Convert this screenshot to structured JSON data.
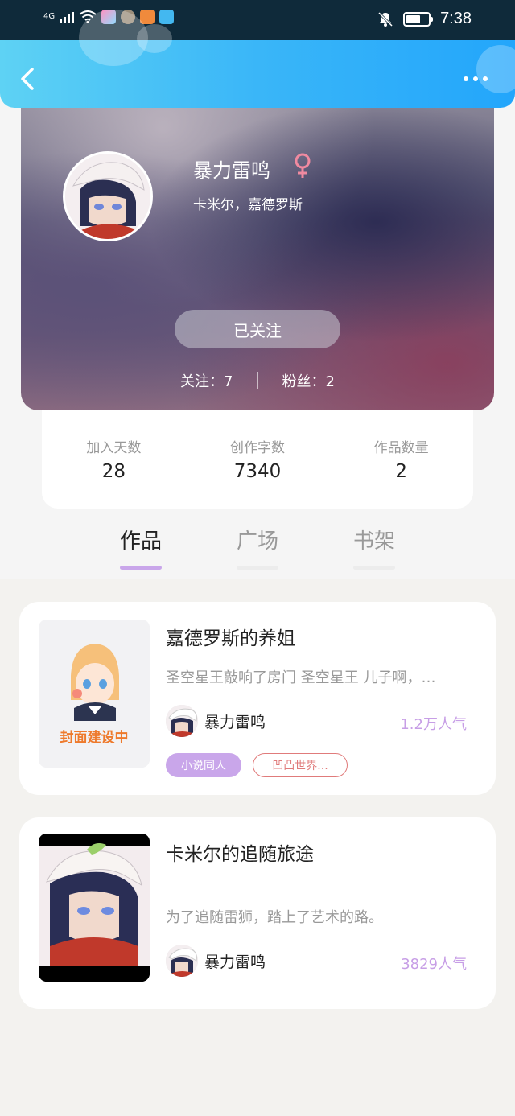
{
  "status_bar": {
    "network": "4G",
    "time": "7:38"
  },
  "profile": {
    "username": "暴力雷鸣",
    "gender_icon": "female-icon",
    "subtitle": "卡米尔，嘉德罗斯",
    "follow_button": "已关注",
    "following": "关注：7",
    "followers": "粉丝：2"
  },
  "stats": [
    {
      "label": "加入天数",
      "value": "28"
    },
    {
      "label": "创作字数",
      "value": "7340"
    },
    {
      "label": "作品数量",
      "value": "2"
    }
  ],
  "tabs": [
    {
      "label": "作品",
      "active": true
    },
    {
      "label": "广场",
      "active": false
    },
    {
      "label": "书架",
      "active": false
    }
  ],
  "works": [
    {
      "title": "嘉德罗斯的养姐",
      "description": "圣空星王敲响了房门 圣空星王 儿子啊，…",
      "cover_text": "封面建设中",
      "author": "暴力雷鸣",
      "popularity": "1.2万人气",
      "tags": [
        "小说同人",
        "凹凸世界..."
      ]
    },
    {
      "title": "卡米尔的追随旅途",
      "description": "为了追随雷狮，踏上了艺术的路。",
      "author": "暴力雷鸣",
      "popularity": "3829人气",
      "tags": []
    }
  ],
  "colors": {
    "nav_gradient_start": "#5ed2f4",
    "nav_gradient_end": "#23a6fb",
    "accent_purple": "#c79ee6",
    "tag_fill": "#c79ee6",
    "tag_outline": "#e07b7b",
    "female_pink": "#f08aa0"
  }
}
